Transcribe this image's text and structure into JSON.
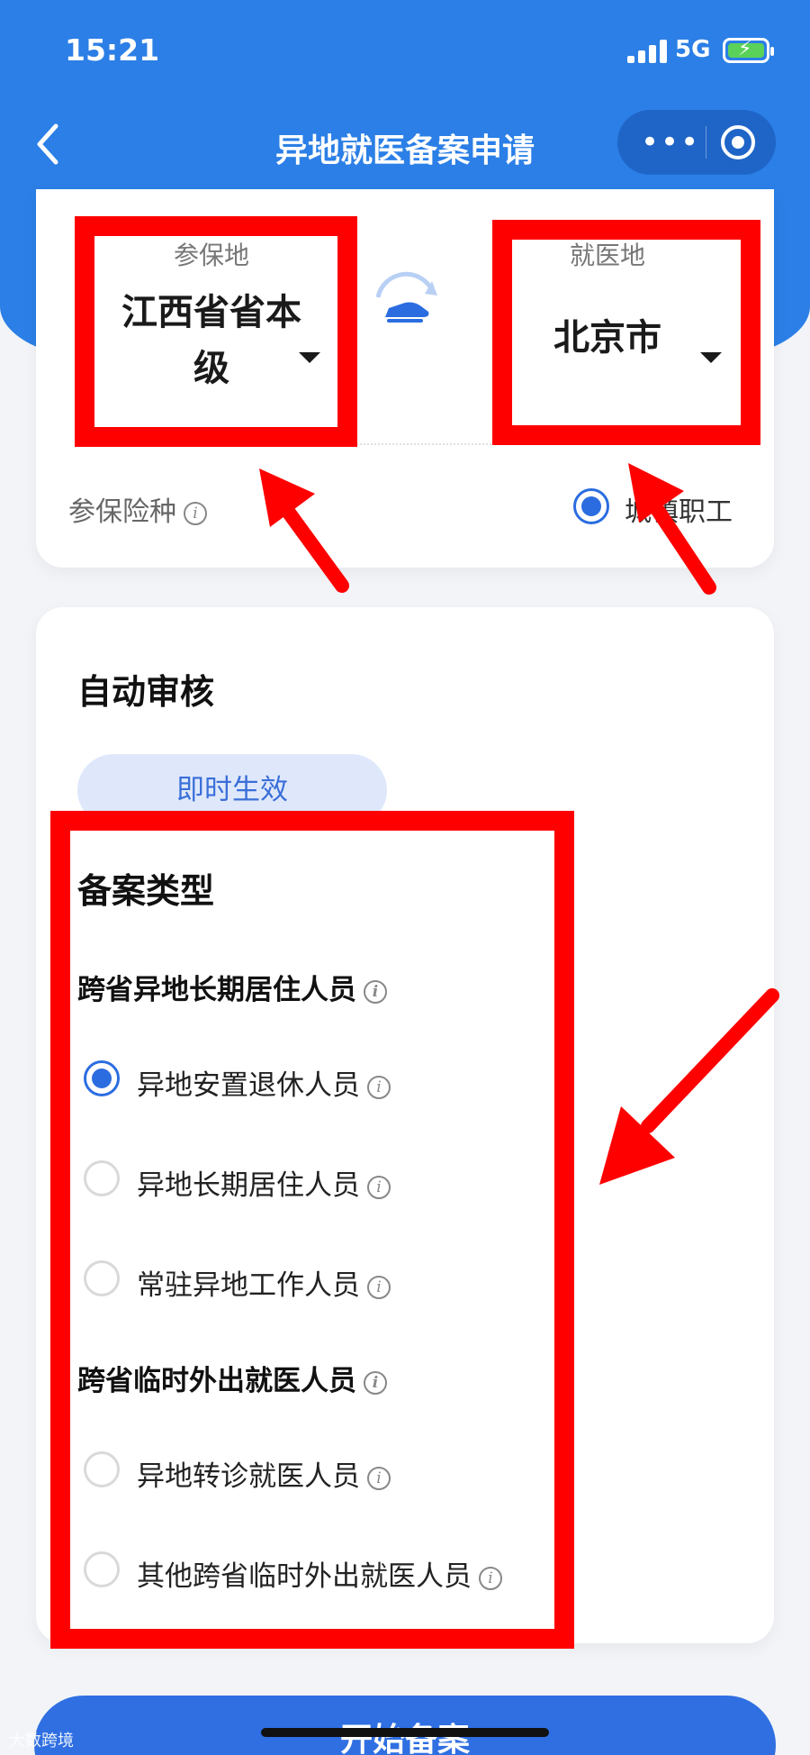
{
  "status_bar": {
    "time": "15:21",
    "network": "5G"
  },
  "nav": {
    "title": "异地就医备案申请",
    "more_icon": "more-dots-icon",
    "target_icon": "target-icon"
  },
  "place": {
    "insured_label": "参保地",
    "insured_value_line1": "江西省省本",
    "insured_value_line2": "级",
    "treatment_label": "就医地",
    "treatment_value": "北京市"
  },
  "insurance": {
    "label": "参保险种",
    "option": "城镇职工"
  },
  "review": {
    "title": "自动审核",
    "badge": "即时生效"
  },
  "filing": {
    "title": "备案类型",
    "group1": "跨省异地长期居住人员",
    "group1_options": [
      "异地安置退休人员",
      "异地长期居住人员",
      "常驻异地工作人员"
    ],
    "group2": "跨省临时外出就医人员",
    "group2_options": [
      "异地转诊就医人员",
      "其他跨省临时外出就医人员"
    ],
    "selected_index": 0
  },
  "bottom": {
    "start_button": "开始备案",
    "watermark": "大数跨境"
  },
  "colors": {
    "brand_blue": "#2b7fe6",
    "radio_blue": "#2b6de0",
    "annotation_red": "#ff0000"
  }
}
